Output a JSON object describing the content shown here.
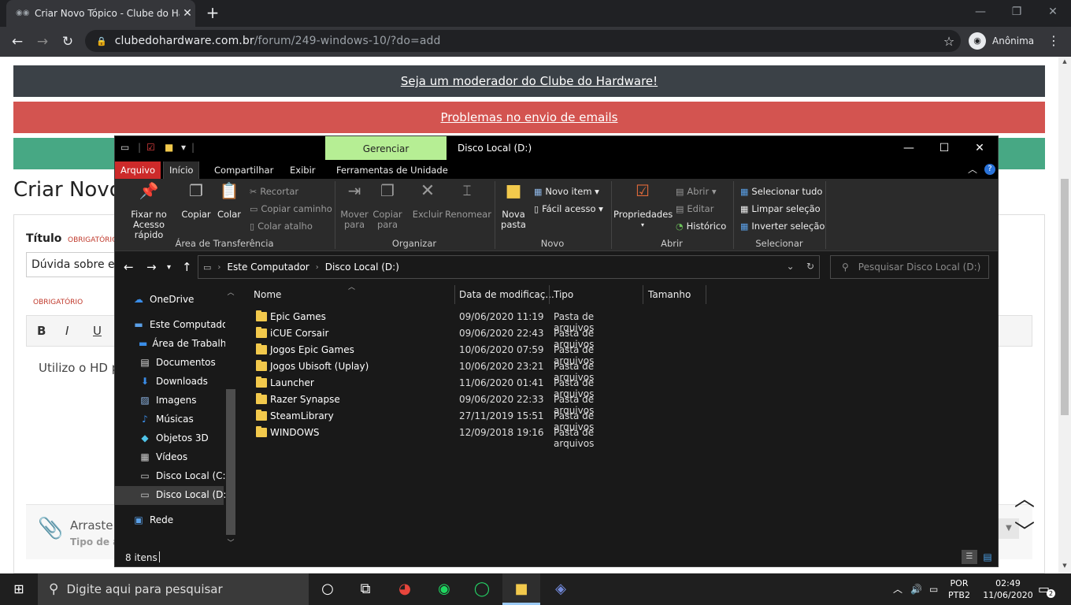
{
  "browser": {
    "tab_title": "Criar Novo Tópico - Clube do Ha",
    "url_host": "clubedohardware.com.br",
    "url_path": "/forum/249-windows-10/?do=add",
    "profile_label": "Anônima"
  },
  "page": {
    "banner1": "Seja um moderador do Clube do Hardware!",
    "banner2": "Problemas no envio de emails",
    "title": "Criar Novo",
    "label_titulo": "Título",
    "required": "OBRIGATÓRIO",
    "title_value": "Dúvida sobre exc",
    "editor_bold": "B",
    "editor_italic": "I",
    "editor_underline": "U",
    "editor_text": "Utilizo o HD pa",
    "attach_text": "Arraste a",
    "attach_sub": "Tipo de a"
  },
  "explorer": {
    "title": "Disco Local (D:)",
    "context_tab": "Gerenciar",
    "tabs": [
      "Arquivo",
      "Início",
      "Compartilhar",
      "Exibir",
      "Ferramentas de Unidade"
    ],
    "ribbon": {
      "pin": "Fixar no Acesso rápido",
      "copy": "Copiar",
      "paste": "Colar",
      "cut": "Recortar",
      "copy_path": "Copiar caminho",
      "paste_shortcut": "Colar atalho",
      "group_clipboard": "Área de Transferência",
      "move_to": "Mover para",
      "copy_to": "Copiar para",
      "delete": "Excluir",
      "rename": "Renomear",
      "group_organize": "Organizar",
      "new_folder": "Nova pasta",
      "new_item": "Novo item",
      "easy_access": "Fácil acesso",
      "group_new": "Novo",
      "properties": "Propriedades",
      "open": "Abrir",
      "edit": "Editar",
      "history": "Histórico",
      "group_open": "Abrir",
      "select_all": "Selecionar tudo",
      "select_none": "Limpar seleção",
      "invert": "Inverter seleção",
      "group_select": "Selecionar"
    },
    "address": [
      "Este Computador",
      "Disco Local (D:)"
    ],
    "search_placeholder": "Pesquisar Disco Local (D:)",
    "nav": [
      "OneDrive",
      "Este Computador",
      "Área de Trabalho",
      "Documentos",
      "Downloads",
      "Imagens",
      "Músicas",
      "Objetos 3D",
      "Vídeos",
      "Disco Local (C:)",
      "Disco Local (D:)",
      "Rede"
    ],
    "columns": [
      "Nome",
      "Data de modificaç...",
      "Tipo",
      "Tamanho"
    ],
    "files": [
      {
        "name": "Epic Games",
        "date": "09/06/2020 11:19",
        "type": "Pasta de arquivos"
      },
      {
        "name": "iCUE Corsair",
        "date": "09/06/2020 22:43",
        "type": "Pasta de arquivos"
      },
      {
        "name": "Jogos Epic Games",
        "date": "10/06/2020 07:59",
        "type": "Pasta de arquivos"
      },
      {
        "name": "Jogos Ubisoft (Uplay)",
        "date": "10/06/2020 23:21",
        "type": "Pasta de arquivos"
      },
      {
        "name": "Launcher",
        "date": "11/06/2020 01:41",
        "type": "Pasta de arquivos"
      },
      {
        "name": "Razer Synapse",
        "date": "09/06/2020 22:33",
        "type": "Pasta de arquivos"
      },
      {
        "name": "SteamLibrary",
        "date": "27/11/2019 15:51",
        "type": "Pasta de arquivos"
      },
      {
        "name": "WINDOWS",
        "date": "12/09/2018 19:16",
        "type": "Pasta de arquivos"
      }
    ],
    "status": "8 itens"
  },
  "taskbar": {
    "search_placeholder": "Digite aqui para pesquisar",
    "lang1": "POR",
    "lang2": "PTB2",
    "time": "02:49",
    "date": "11/06/2020",
    "notif_count": "2"
  }
}
